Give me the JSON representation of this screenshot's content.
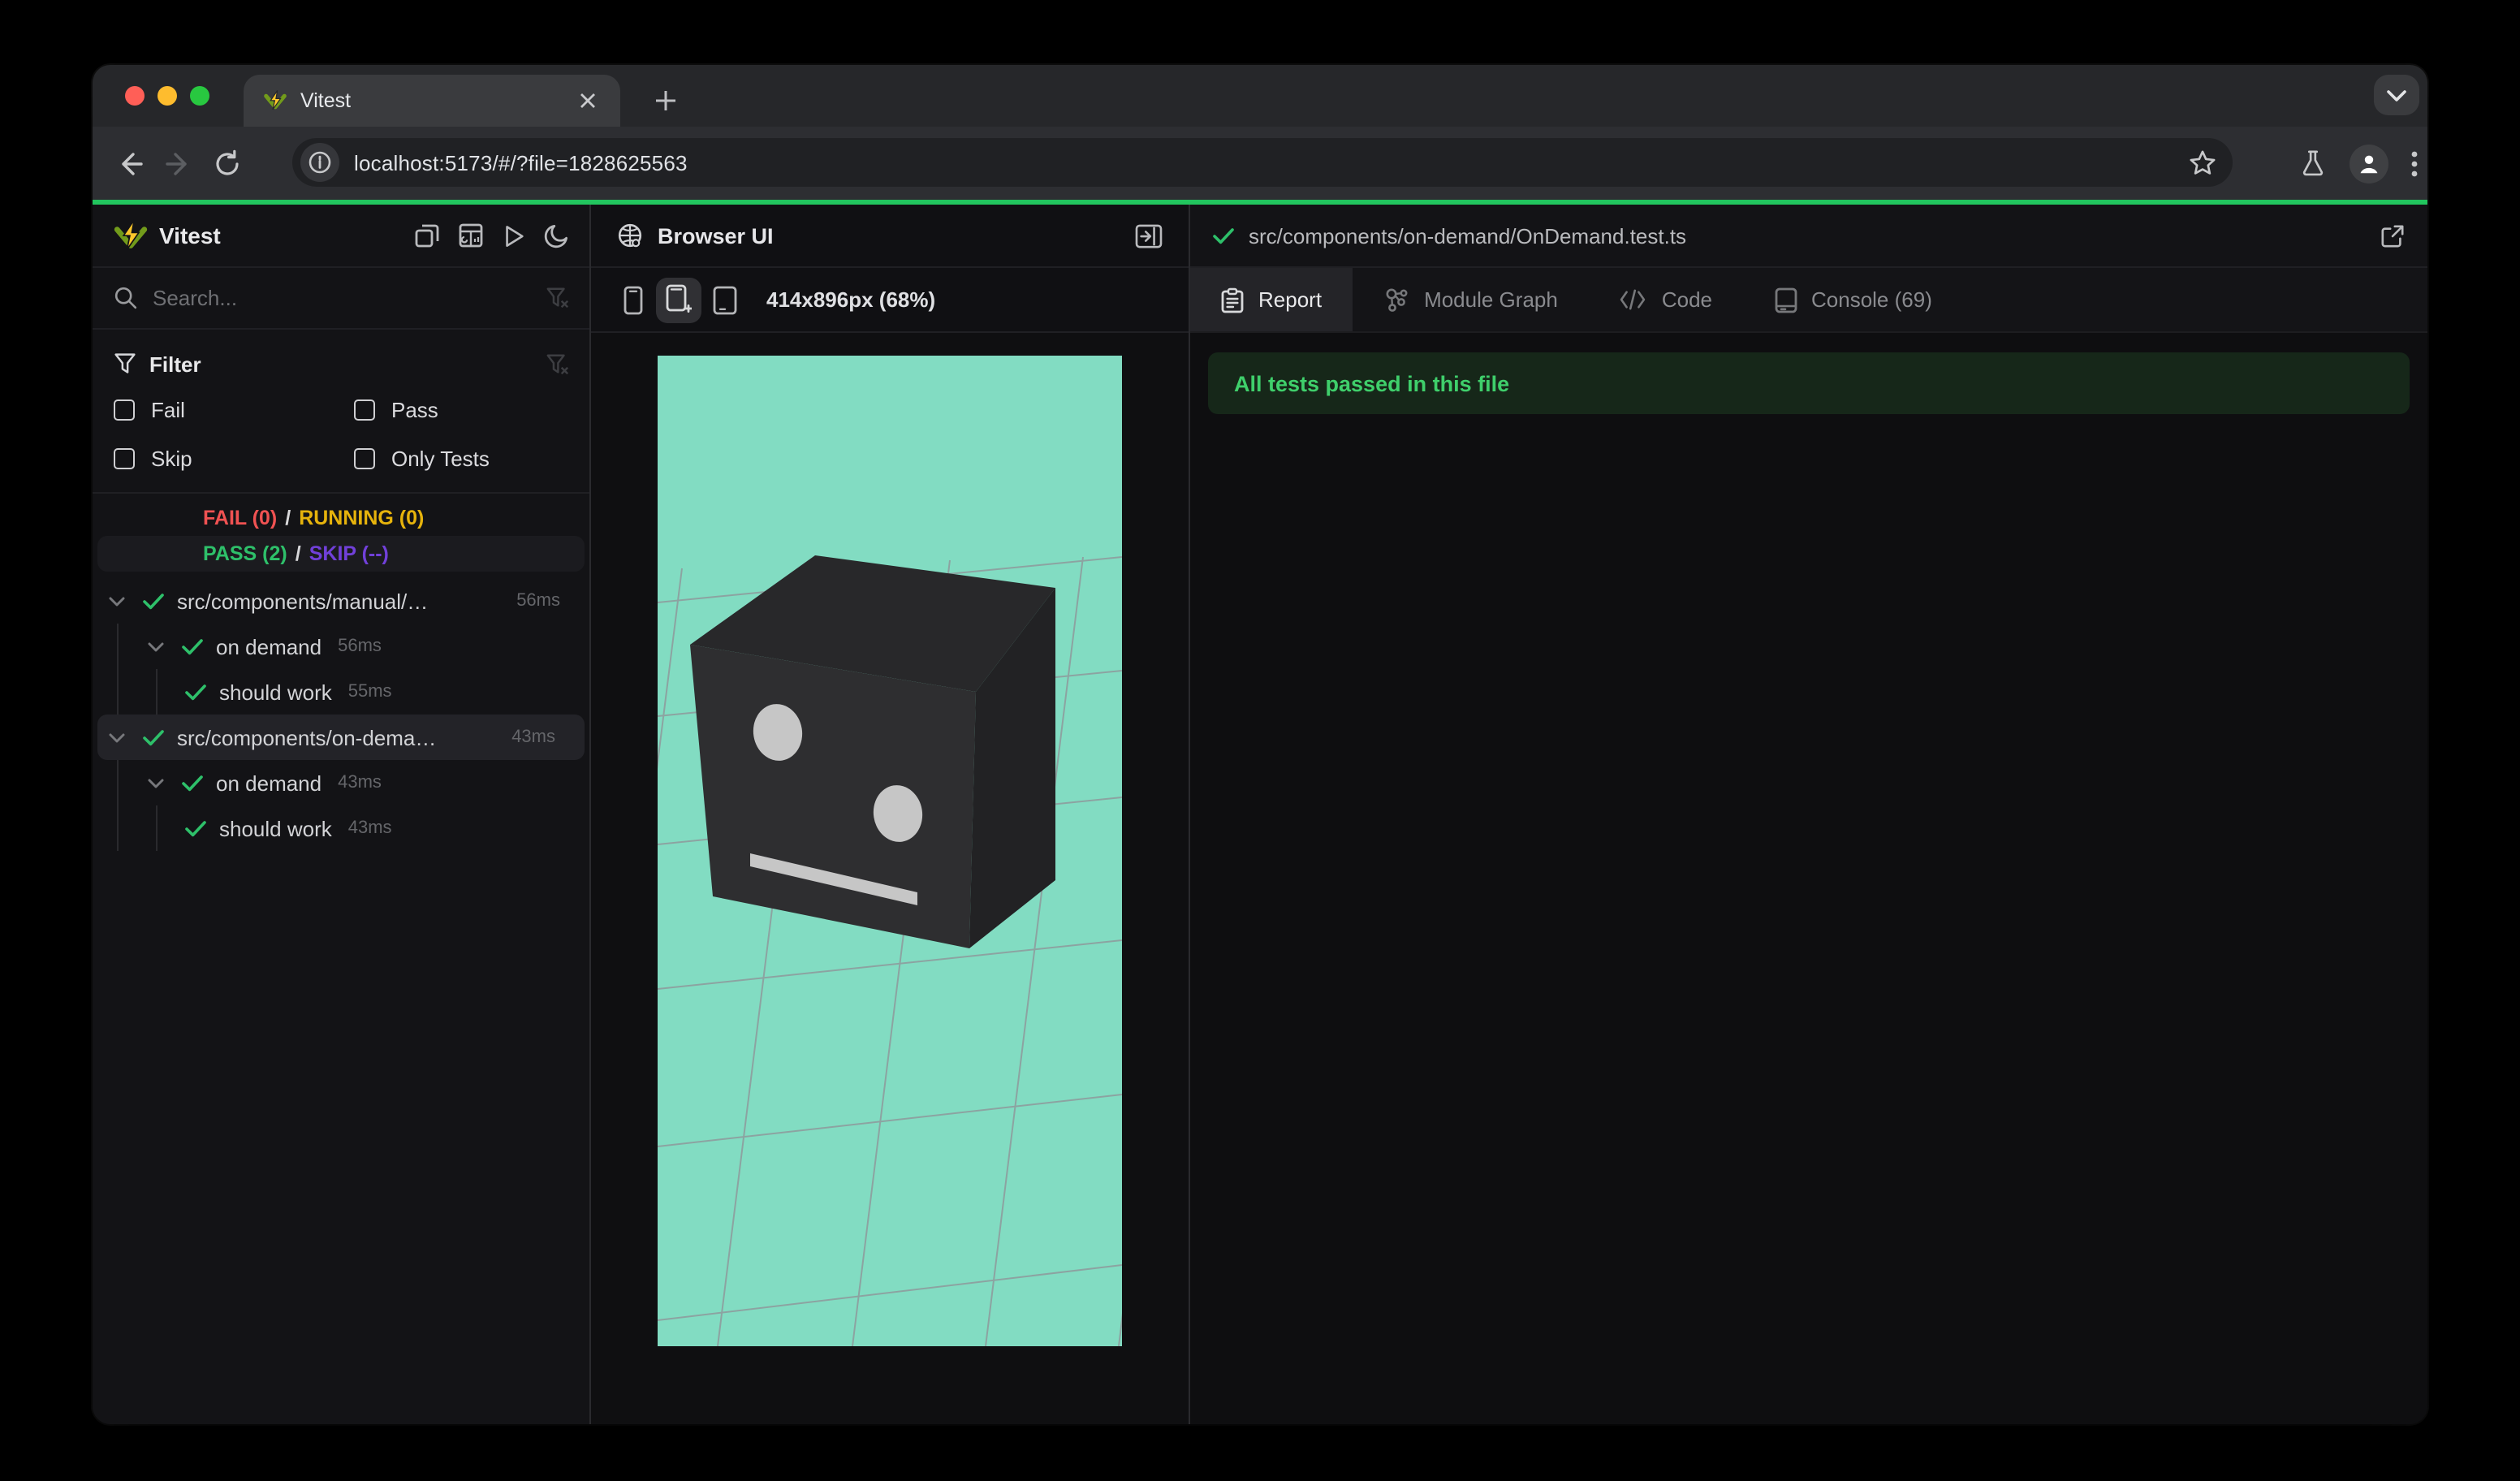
{
  "chrome": {
    "tab_title": "Vitest",
    "url": "localhost:5173/#/?file=1828625563"
  },
  "sidebar": {
    "title": "Vitest",
    "search_placeholder": "Search...",
    "filter": {
      "title": "Filter",
      "options": [
        {
          "label": "Fail"
        },
        {
          "label": "Pass"
        },
        {
          "label": "Skip"
        },
        {
          "label": "Only Tests"
        }
      ]
    },
    "status": {
      "fail": "FAIL (0)",
      "sep1": "/",
      "running": "RUNNING (0)",
      "pass": "PASS (2)",
      "sep2": "/",
      "skip": "SKIP (--)"
    },
    "tree": [
      {
        "label": "src/components/manual/…",
        "duration": "56ms",
        "type": "file"
      },
      {
        "label": "on demand",
        "duration": "56ms",
        "type": "suite"
      },
      {
        "label": "should work",
        "duration": "55ms",
        "type": "test"
      },
      {
        "label": "src/components/on-dema…",
        "duration": "43ms",
        "type": "file",
        "selected": true
      },
      {
        "label": "on demand",
        "duration": "43ms",
        "type": "suite"
      },
      {
        "label": "should work",
        "duration": "43ms",
        "type": "test"
      }
    ]
  },
  "browser_panel": {
    "title": "Browser UI",
    "size_label": "414x896px (68%)"
  },
  "report_panel": {
    "file_path": "src/components/on-demand/OnDemand.test.ts",
    "tabs": [
      {
        "label": "Report"
      },
      {
        "label": "Module Graph"
      },
      {
        "label": "Code"
      },
      {
        "label": "Console (69)"
      }
    ],
    "banner": "All tests passed in this file"
  },
  "icons": {
    "sidebar_actions": [
      "windows-stack-icon",
      "dashboard-icon",
      "run-all-icon",
      "dark-mode-moon-icon"
    ],
    "search": "magnifier",
    "filter": "funnel",
    "clear_filter": "funnel-x",
    "device_presets": [
      "phone-icon",
      "phone-plus-icon",
      "tablet-icon"
    ],
    "report_tabs": [
      "report-clipboard-icon",
      "module-graph-icon",
      "code-icon",
      "console-icon"
    ]
  },
  "colors": {
    "progress_green": "#22c55e",
    "pass_green": "#2ec06a",
    "fail_red": "#f05252",
    "running_amber": "#e6b30c",
    "skip_purple": "#7140d9",
    "banner_bg": "#162719",
    "banner_text": "#3fcf6b",
    "viewport_teal": "#82dcc2",
    "cube_front": "#2e2e30",
    "cube_top": "#28282a",
    "cube_side": "#222224",
    "cube_face_features": "#c6c6c6",
    "vitest_bolt_yellow": "#fcc72b",
    "vitest_chevron_green": "#729b1b"
  }
}
